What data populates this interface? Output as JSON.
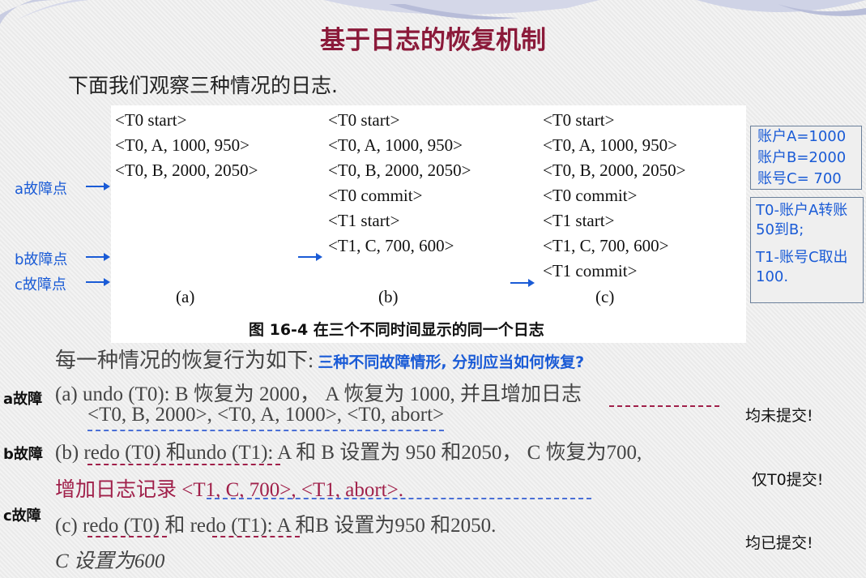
{
  "title": "基于日志的恢复机制",
  "subtitle": "下面我们观察三种情况的日志.",
  "figure": {
    "columns": [
      {
        "lines": [
          "<T0 start>",
          "<T0, A, 1000, 950>",
          "<T0, B, 2000, 2050>"
        ],
        "label": "(a)"
      },
      {
        "lines": [
          "<T0 start>",
          "<T0, A, 1000, 950>",
          "<T0, B, 2000, 2050>",
          "<T0 commit>",
          "<T1 start>",
          "<T1, C, 700, 600>"
        ],
        "label": "(b)"
      },
      {
        "lines": [
          "<T0 start>",
          "<T0, A, 1000, 950>",
          "<T0, B, 2000, 2050>",
          "<T0 commit>",
          "<T1 start>",
          "<T1, C, 700, 600>",
          "<T1 commit>"
        ],
        "label": "(c)"
      }
    ],
    "caption": "图 16-4   在三个不同时间显示的同一个日志"
  },
  "fault_points": {
    "a": "a故障点",
    "b": "b故障点",
    "c": "c故障点"
  },
  "account_box": {
    "lines": [
      "账户A=1000",
      "账户B=2000",
      "账号C= 700"
    ]
  },
  "txn_box": {
    "t0": "T0-账户A转账50到B;",
    "t1": "T1-账号C取出100."
  },
  "recovery_intro": "每一种情况的恢复行为如下:",
  "recovery_question": "三种不同故障情形, 分别应当如何恢复?",
  "cases": {
    "a": {
      "tag": "a故障",
      "line1": "(a)  undo (T0): B 恢复为 2000，  A 恢复为 1000, 并且增加日志",
      "line2": "<T0, B, 2000>, <T0, A, 1000>, <T0, abort>",
      "note": "均未提交!"
    },
    "b": {
      "tag": "b故障",
      "line1": "(b) redo (T0) 和undo (T1): A 和 B 设置为 950 和2050，  C 恢复为700,",
      "line2": "增加日志记录 <T1, C, 700>, <T1, abort>.",
      "note": "仅T0提交!"
    },
    "c": {
      "tag": "c故障",
      "line1": "(c) redo (T0) 和 redo (T1): A 和B 设置为950 和2050.",
      "line2": "C 设置为600",
      "note": "均已提交!"
    }
  }
}
